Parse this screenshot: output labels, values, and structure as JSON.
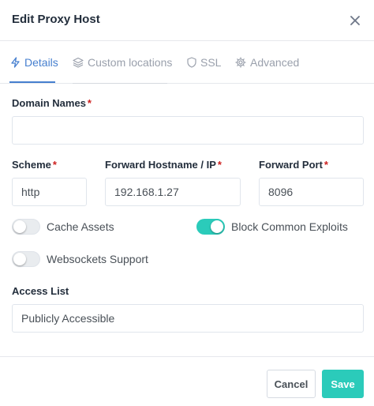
{
  "modal": {
    "title": "Edit Proxy Host"
  },
  "tabs": [
    {
      "label": "Details",
      "icon": "bolt-icon",
      "active": true
    },
    {
      "label": "Custom locations",
      "icon": "layers-icon",
      "active": false
    },
    {
      "label": "SSL",
      "icon": "shield-icon",
      "active": false
    },
    {
      "label": "Advanced",
      "icon": "gear-icon",
      "active": false
    }
  ],
  "form": {
    "domain_names": {
      "label": "Domain Names",
      "required": "*",
      "value": ""
    },
    "scheme": {
      "label": "Scheme",
      "required": "*",
      "value": "http"
    },
    "forward_host": {
      "label": "Forward Hostname / IP",
      "required": "*",
      "value": "192.168.1.27"
    },
    "forward_port": {
      "label": "Forward Port",
      "required": "*",
      "value": "8096"
    },
    "cache_assets": {
      "label": "Cache Assets",
      "on": false
    },
    "block_exploits": {
      "label": "Block Common Exploits",
      "on": true
    },
    "websockets": {
      "label": "Websockets Support",
      "on": false
    },
    "access_list": {
      "label": "Access List",
      "value": "Publicly Accessible"
    }
  },
  "footer": {
    "cancel_label": "Cancel",
    "save_label": "Save"
  },
  "colors": {
    "accent": "#467fcf",
    "primary_teal": "#2bcbba",
    "required_red": "#cd201f"
  }
}
